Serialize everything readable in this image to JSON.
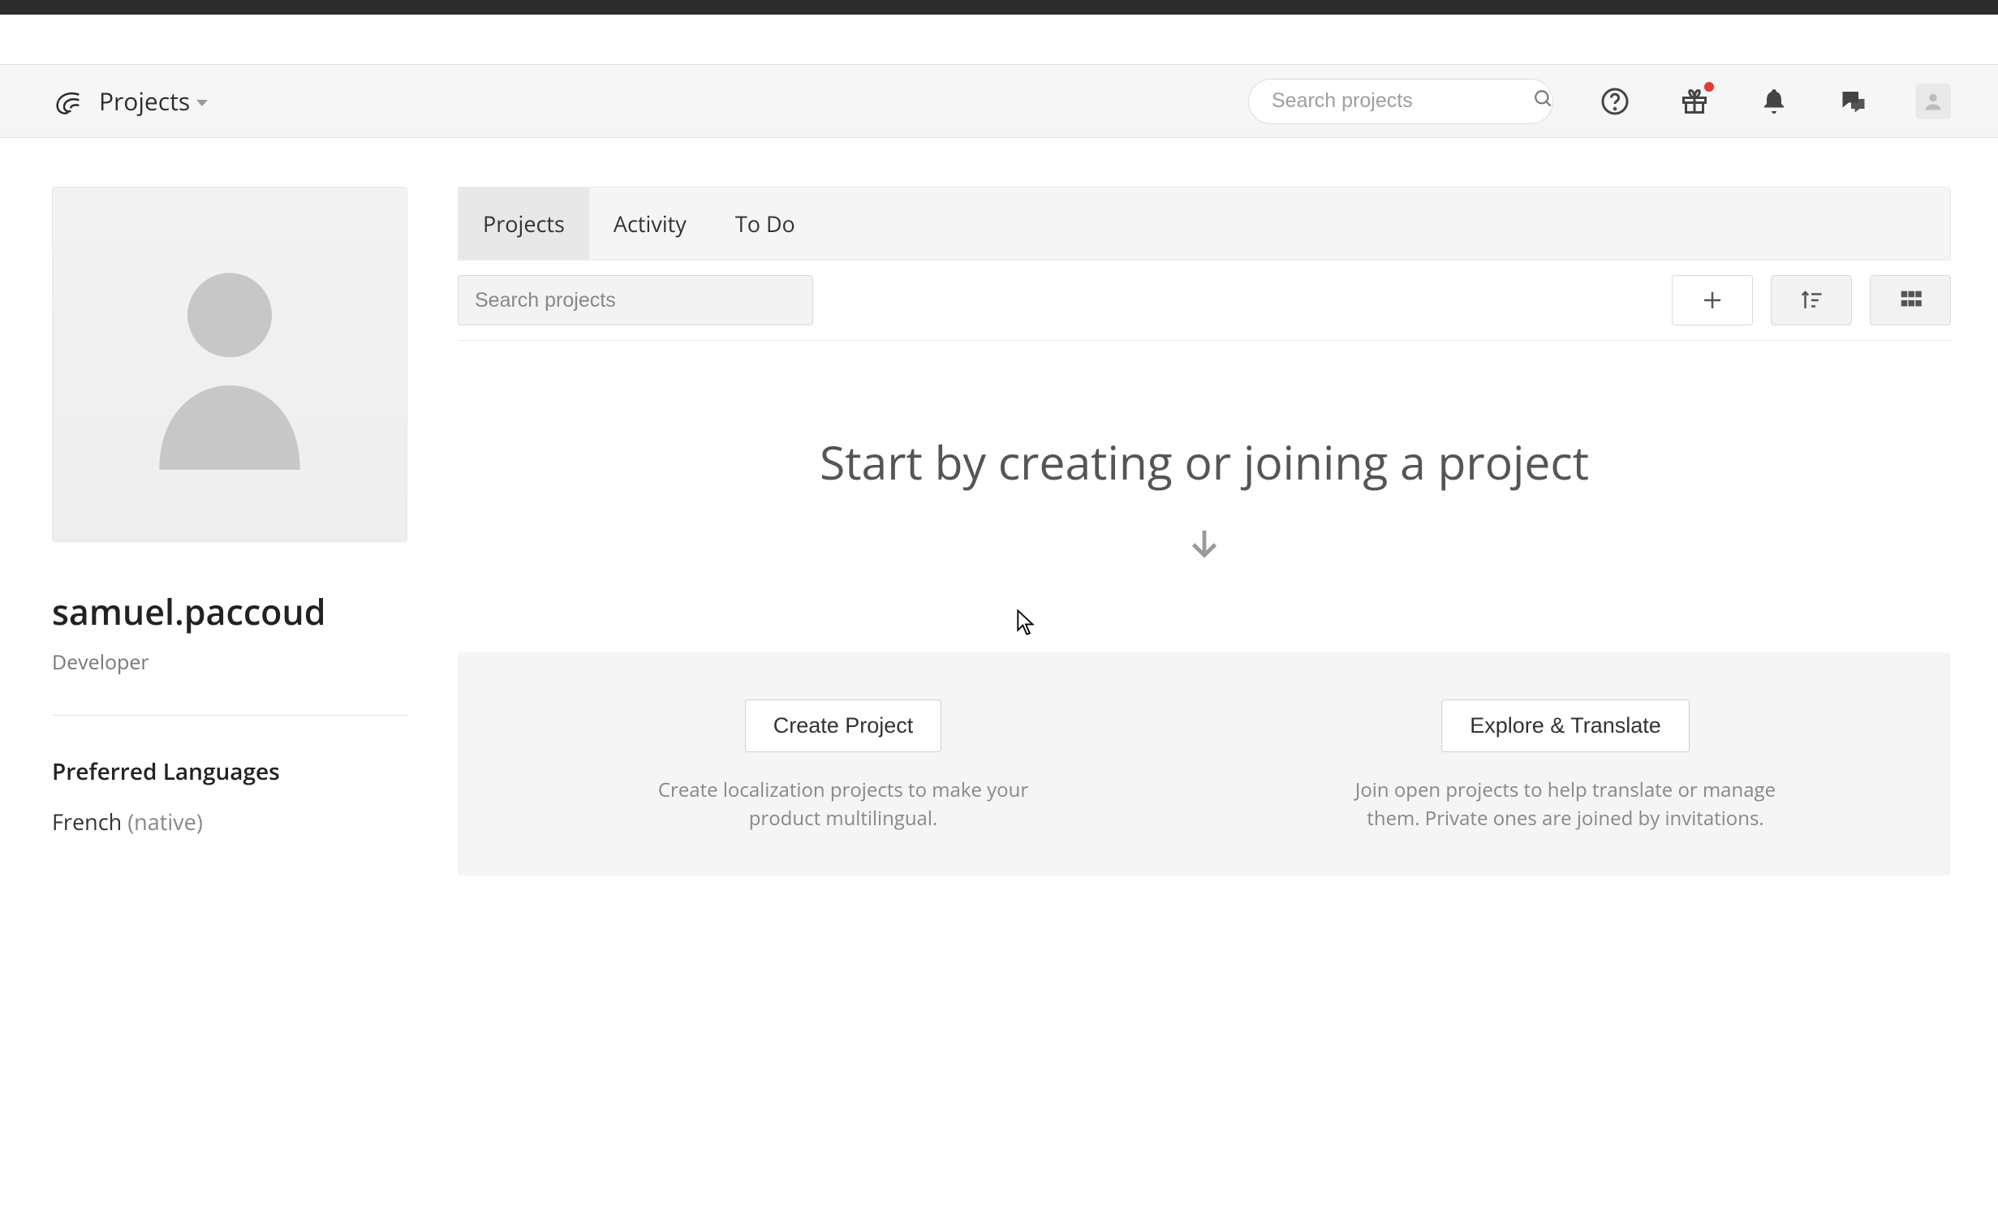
{
  "nav": {
    "projects_dropdown_label": "Projects",
    "search_placeholder": "Search projects"
  },
  "sidebar": {
    "username": "samuel.paccoud",
    "role": "Developer",
    "pref_heading": "Preferred Languages",
    "language": "French",
    "language_note": "(native)"
  },
  "tabs": {
    "items": [
      {
        "label": "Projects"
      },
      {
        "label": "Activity"
      },
      {
        "label": "To Do"
      }
    ]
  },
  "toolbar": {
    "search_placeholder": "Search projects"
  },
  "empty": {
    "heading": "Start by creating or joining a project",
    "create_button": "Create Project",
    "create_desc": "Create localization projects to make your product multilingual.",
    "explore_button": "Explore & Translate",
    "explore_desc": "Join open projects to help translate or manage them. Private ones are joined by invitations."
  }
}
